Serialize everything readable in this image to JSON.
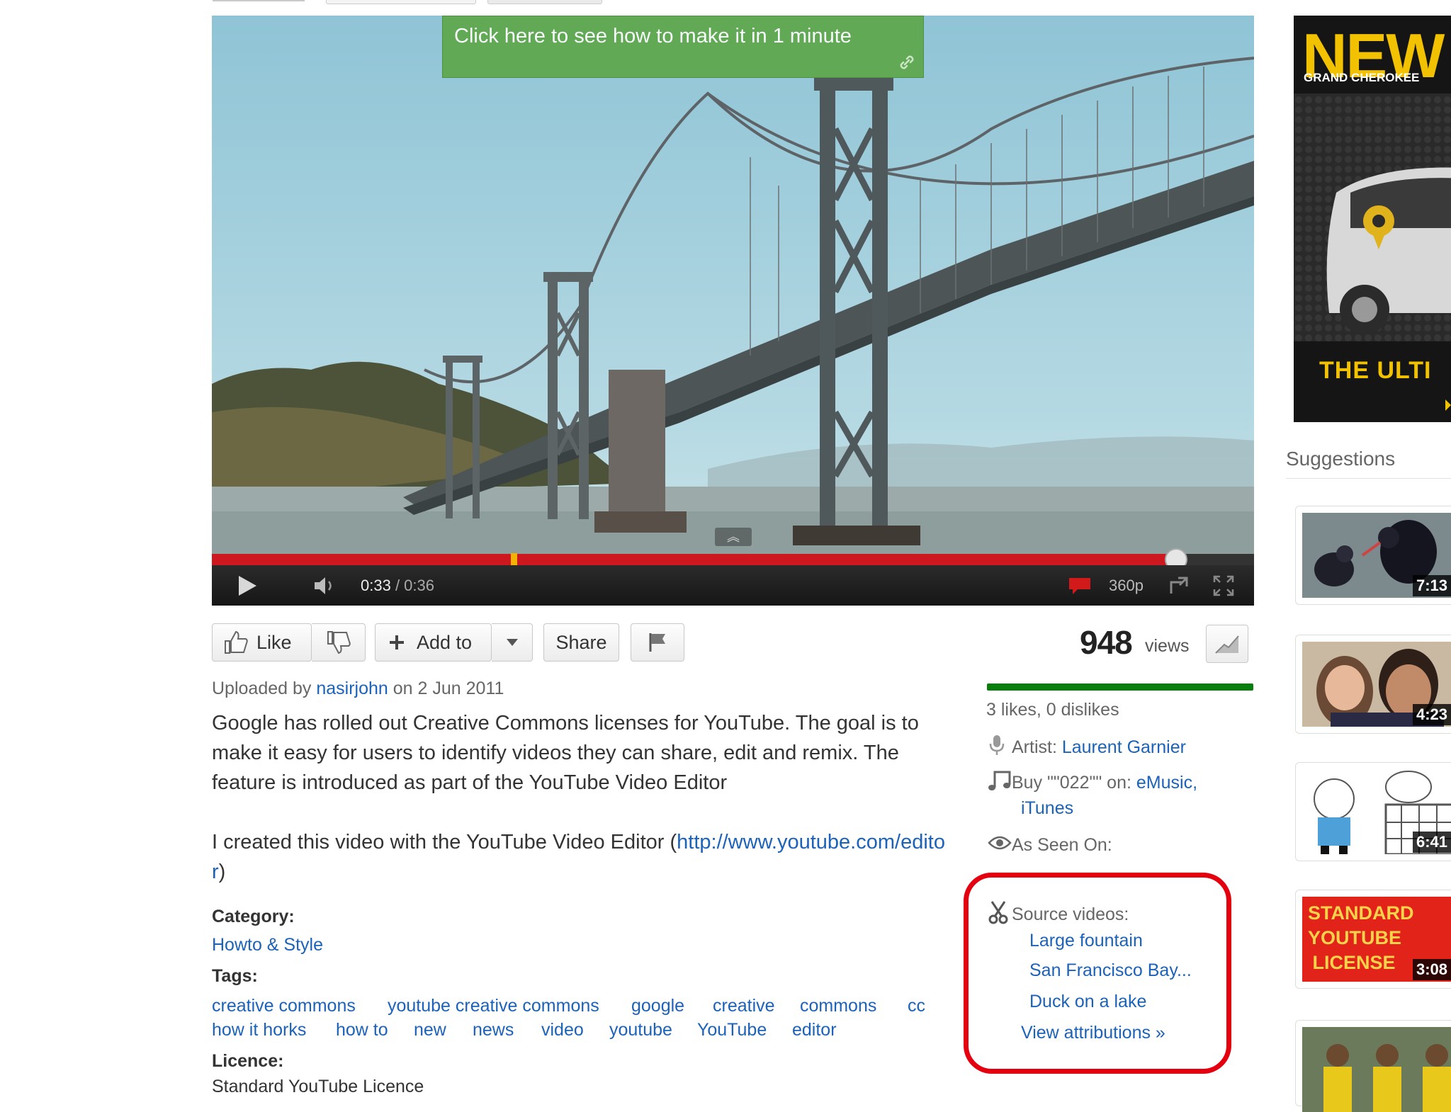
{
  "player": {
    "annotation_text": "Click here to see how to make it in 1 minute",
    "time_current": "0:33",
    "time_separator": " / ",
    "time_duration": "0:36",
    "quality": "360p",
    "progress_fraction": 0.925
  },
  "actions": {
    "like_label": "Like",
    "add_to_label": "Add to",
    "share_label": "Share"
  },
  "stats": {
    "views_count": "948",
    "views_label": "views",
    "likes_text": "3 likes, 0 dislikes"
  },
  "upload": {
    "prefix": "Uploaded by ",
    "user": "nasirjohn",
    "suffix": " on 2 Jun 2011"
  },
  "description": {
    "paragraph1": "Google has rolled out Creative Commons licenses for YouTube. The goal is to make it easy for users to identify videos they can share, edit and remix. The feature is introduced as part of the YouTube Video Editor",
    "paragraph2_prefix": "I created this video with the YouTube Video Editor (",
    "paragraph2_link": "http://www.youtube.com/editor",
    "paragraph2_suffix": ")"
  },
  "metadata": {
    "category_label": "Category:",
    "category_value": "Howto & Style",
    "tags_label": "Tags:",
    "tags": [
      "creative commons",
      "youtube creative commons",
      "google",
      "creative",
      "commons",
      "cc",
      "how it horks",
      "how to",
      "new",
      "news",
      "video",
      "youtube",
      "YouTube",
      "editor"
    ],
    "licence_label": "Licence:",
    "licence_value": "Standard YouTube Licence"
  },
  "music": {
    "artist_label": "Artist: ",
    "artist_name": "Laurent Garnier",
    "buy_label": "Buy \"\"022\"\" on: ",
    "buy_link1": "eMusic,",
    "buy_link2": "iTunes",
    "as_seen_on_label": "As Seen On:"
  },
  "source_videos": {
    "label": "Source videos:",
    "items": [
      "Large fountain",
      "San Francisco Bay...",
      "Duck on a lake"
    ],
    "view_attributions": "View attributions »"
  },
  "ad": {
    "headline": "NEW",
    "subheadline": "GRAND CHEROKEE",
    "tagline": "THE ULTI"
  },
  "suggestions": {
    "header": "Suggestions",
    "items": [
      {
        "duration": "7:13"
      },
      {
        "duration": "4:23"
      },
      {
        "duration": "6:41"
      },
      {
        "duration": "3:08",
        "thumb_text": "STANDARD YOUTUBE LICENSE"
      },
      {
        "duration": ""
      }
    ]
  },
  "colors": {
    "link": "#1c62b9",
    "progress_red": "#cc181e",
    "like_bar_green": "#087e0c",
    "annotation_green": "#5fa84e",
    "highlight_red": "#e4000f",
    "ad_yellow": "#f2c200"
  }
}
